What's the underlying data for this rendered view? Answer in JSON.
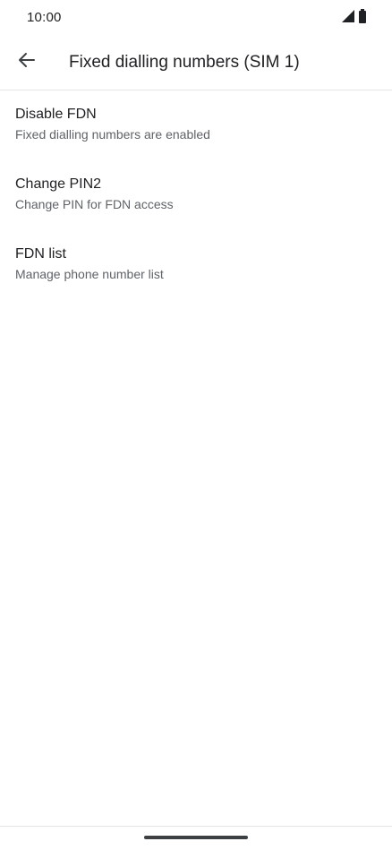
{
  "status_bar": {
    "time": "10:00",
    "icons": [
      "cellular-signal-icon",
      "battery-icon"
    ]
  },
  "app_bar": {
    "back_icon": "arrow-back-icon",
    "title": "Fixed dialling numbers (SIM 1)"
  },
  "preferences": [
    {
      "title": "Disable FDN",
      "summary": "Fixed dialling numbers are enabled"
    },
    {
      "title": "Change PIN2",
      "summary": "Change PIN for FDN access"
    },
    {
      "title": "FDN list",
      "summary": "Manage phone number list"
    }
  ],
  "colors": {
    "text_primary": "#202124",
    "text_secondary": "#5f6368",
    "background": "#ffffff",
    "divider": "#e6e6e6"
  }
}
